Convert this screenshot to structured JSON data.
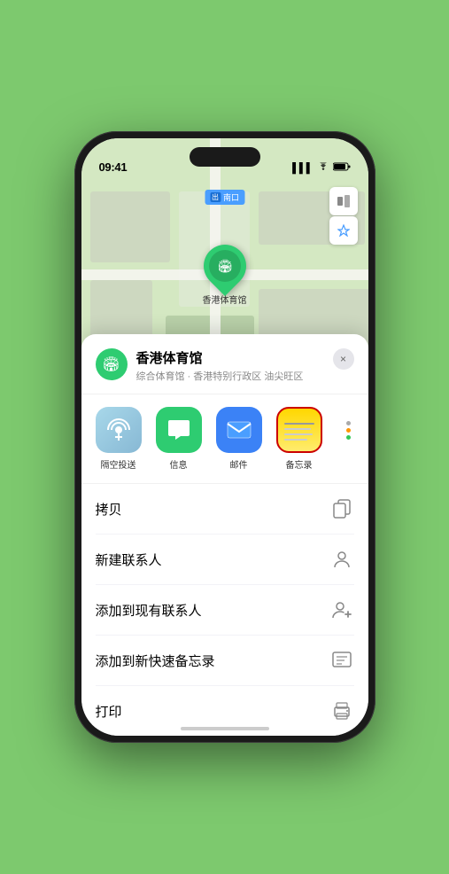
{
  "status_bar": {
    "time": "09:41",
    "signal_icon": "▌▌▌",
    "wifi_icon": "WiFi",
    "battery_icon": "🔋"
  },
  "map": {
    "label": "南口",
    "marker_label": "香港体育馆",
    "marker_emoji": "🏟"
  },
  "location_card": {
    "title": "香港体育馆",
    "subtitle": "综合体育馆 · 香港特别行政区 油尖旺区",
    "close_label": "×"
  },
  "share_items": [
    {
      "id": "airdrop",
      "label": "隔空投送",
      "emoji": "📶"
    },
    {
      "id": "messages",
      "label": "信息",
      "emoji": "💬"
    },
    {
      "id": "mail",
      "label": "邮件",
      "emoji": "✉️"
    },
    {
      "id": "notes",
      "label": "备忘录",
      "emoji": ""
    }
  ],
  "actions": [
    {
      "id": "copy",
      "label": "拷贝",
      "icon": "📋"
    },
    {
      "id": "new-contact",
      "label": "新建联系人",
      "icon": "👤"
    },
    {
      "id": "add-to-contact",
      "label": "添加到现有联系人",
      "icon": "👤+"
    },
    {
      "id": "quick-note",
      "label": "添加到新快速备忘录",
      "icon": "📝"
    },
    {
      "id": "print",
      "label": "打印",
      "icon": "🖨"
    }
  ]
}
